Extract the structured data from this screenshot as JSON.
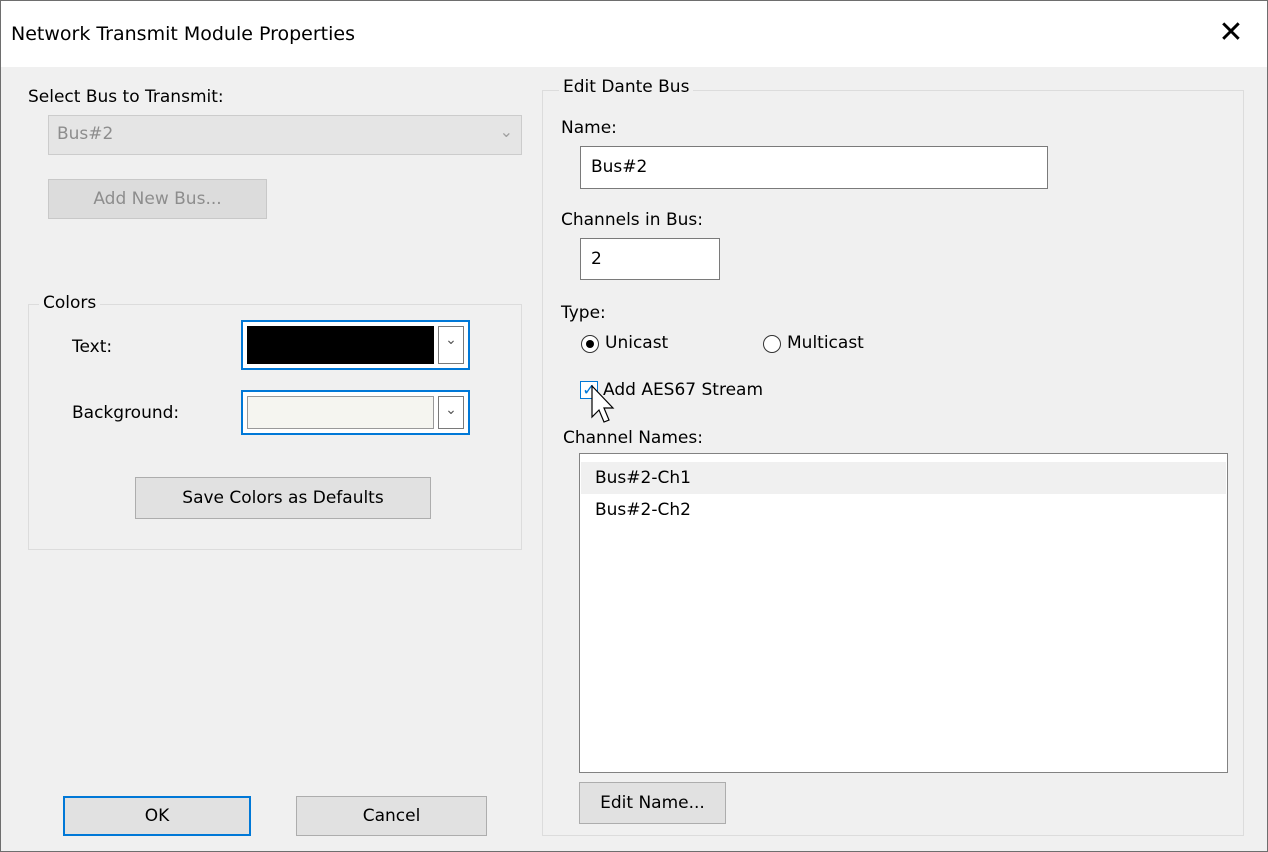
{
  "window": {
    "title": "Network Transmit Module Properties",
    "close_glyph": "✕"
  },
  "left": {
    "select_bus_label": "Select Bus to Transmit:",
    "bus_select_value": "Bus#2",
    "add_bus_button": "Add New Bus...",
    "colors_group_title": "Colors",
    "text_label": "Text:",
    "text_color": "#000000",
    "background_label": "Background:",
    "background_color": "#f5f5f0",
    "save_colors_button": "Save Colors as Defaults"
  },
  "right": {
    "group_title": "Edit Dante Bus",
    "name_label": "Name:",
    "name_value": "Bus#2",
    "channels_label": "Channels in Bus:",
    "channels_value": "2",
    "type_label": "Type:",
    "unicast_label": "Unicast",
    "unicast_selected": true,
    "multicast_label": "Multicast",
    "aes67_label": "Add AES67 Stream",
    "aes67_checked": true,
    "channel_names_label": "Channel Names:",
    "channel_names": [
      "Bus#2-Ch1",
      "Bus#2-Ch2"
    ],
    "edit_name_button": "Edit Name..."
  },
  "footer": {
    "ok_button": "OK",
    "cancel_button": "Cancel"
  }
}
